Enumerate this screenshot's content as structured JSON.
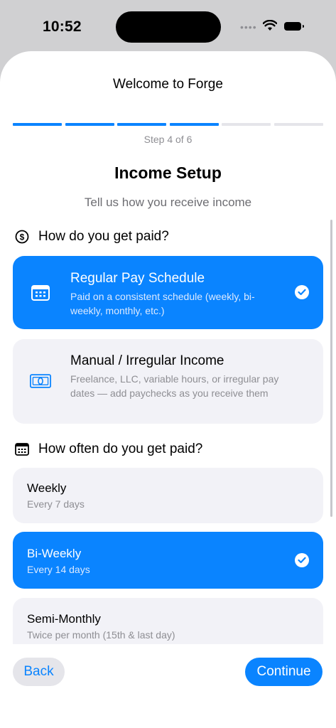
{
  "status_bar": {
    "time": "10:52",
    "signal": "••••",
    "wifi_icon": "wifi-icon",
    "battery_icon": "battery-icon"
  },
  "header": {
    "title": "Welcome to Forge",
    "step_label": "Step 4 of 6",
    "total_steps": 6,
    "completed_steps": 4
  },
  "colors": {
    "accent": "#0a84ff",
    "card_bg": "#f2f2f7",
    "progress_inactive": "#e5e5ea"
  },
  "page": {
    "title": "Income Setup",
    "subtitle": "Tell us how you receive income"
  },
  "pay_method": {
    "heading": "How do you get paid?",
    "heading_icon": "dollar-circle-icon",
    "options": [
      {
        "title": "Regular Pay Schedule",
        "description": "Paid on a consistent schedule (weekly, bi-weekly, monthly, etc.)",
        "icon": "calendar-icon",
        "selected": true
      },
      {
        "title": "Manual / Irregular Income",
        "description": "Freelance, LLC, variable hours, or irregular pay dates — add paychecks as you receive them",
        "icon": "banknote-icon",
        "selected": false
      }
    ]
  },
  "frequency": {
    "heading": "How often do you get paid?",
    "heading_icon": "calendar-icon",
    "options": [
      {
        "title": "Weekly",
        "description": "Every 7 days",
        "selected": false
      },
      {
        "title": "Bi-Weekly",
        "description": "Every 14 days",
        "selected": true
      },
      {
        "title": "Semi-Monthly",
        "description": "Twice per month (15th & last day)",
        "selected": false
      }
    ]
  },
  "footer": {
    "back_label": "Back",
    "continue_label": "Continue"
  }
}
